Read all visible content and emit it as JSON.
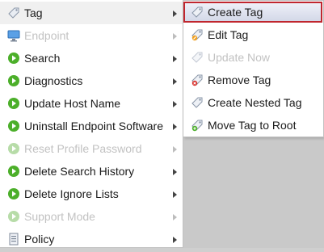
{
  "menu": {
    "items": [
      {
        "label": "Tag",
        "enabled": true,
        "has_submenu": true,
        "icon": "tag-icon",
        "selected": true
      },
      {
        "label": "Endpoint",
        "enabled": false,
        "has_submenu": true,
        "icon": "monitor-icon"
      },
      {
        "label": "Search",
        "enabled": true,
        "has_submenu": true,
        "icon": "green-arrow-icon"
      },
      {
        "label": "Diagnostics",
        "enabled": true,
        "has_submenu": true,
        "icon": "green-arrow-icon"
      },
      {
        "label": "Update Host Name",
        "enabled": true,
        "has_submenu": true,
        "icon": "green-arrow-icon"
      },
      {
        "label": "Uninstall Endpoint Software",
        "enabled": true,
        "has_submenu": true,
        "icon": "green-arrow-icon"
      },
      {
        "label": "Reset Profile Password",
        "enabled": false,
        "has_submenu": true,
        "icon": "green-arrow-icon"
      },
      {
        "label": "Delete Search History",
        "enabled": true,
        "has_submenu": true,
        "icon": "green-arrow-icon"
      },
      {
        "label": "Delete Ignore Lists",
        "enabled": true,
        "has_submenu": true,
        "icon": "green-arrow-icon"
      },
      {
        "label": "Support Mode",
        "enabled": false,
        "has_submenu": true,
        "icon": "green-arrow-icon"
      },
      {
        "label": "Policy",
        "enabled": true,
        "has_submenu": true,
        "icon": "policy-document-icon"
      }
    ]
  },
  "submenu": {
    "items": [
      {
        "label": "Create Tag",
        "enabled": true,
        "icon": "tag-icon",
        "highlighted": true
      },
      {
        "label": "Edit Tag",
        "enabled": true,
        "icon": "tag-edit-icon"
      },
      {
        "label": "Update Now",
        "enabled": false,
        "icon": "tag-refresh-icon"
      },
      {
        "label": "Remove Tag",
        "enabled": true,
        "icon": "tag-remove-icon"
      },
      {
        "label": "Create Nested Tag",
        "enabled": true,
        "icon": "tag-nested-icon"
      },
      {
        "label": "Move Tag to Root",
        "enabled": true,
        "icon": "tag-move-icon"
      }
    ]
  },
  "colors": {
    "highlight_border": "#c0262e",
    "disabled_text": "#c2c2c2",
    "green_icon": "#4caf2a"
  }
}
